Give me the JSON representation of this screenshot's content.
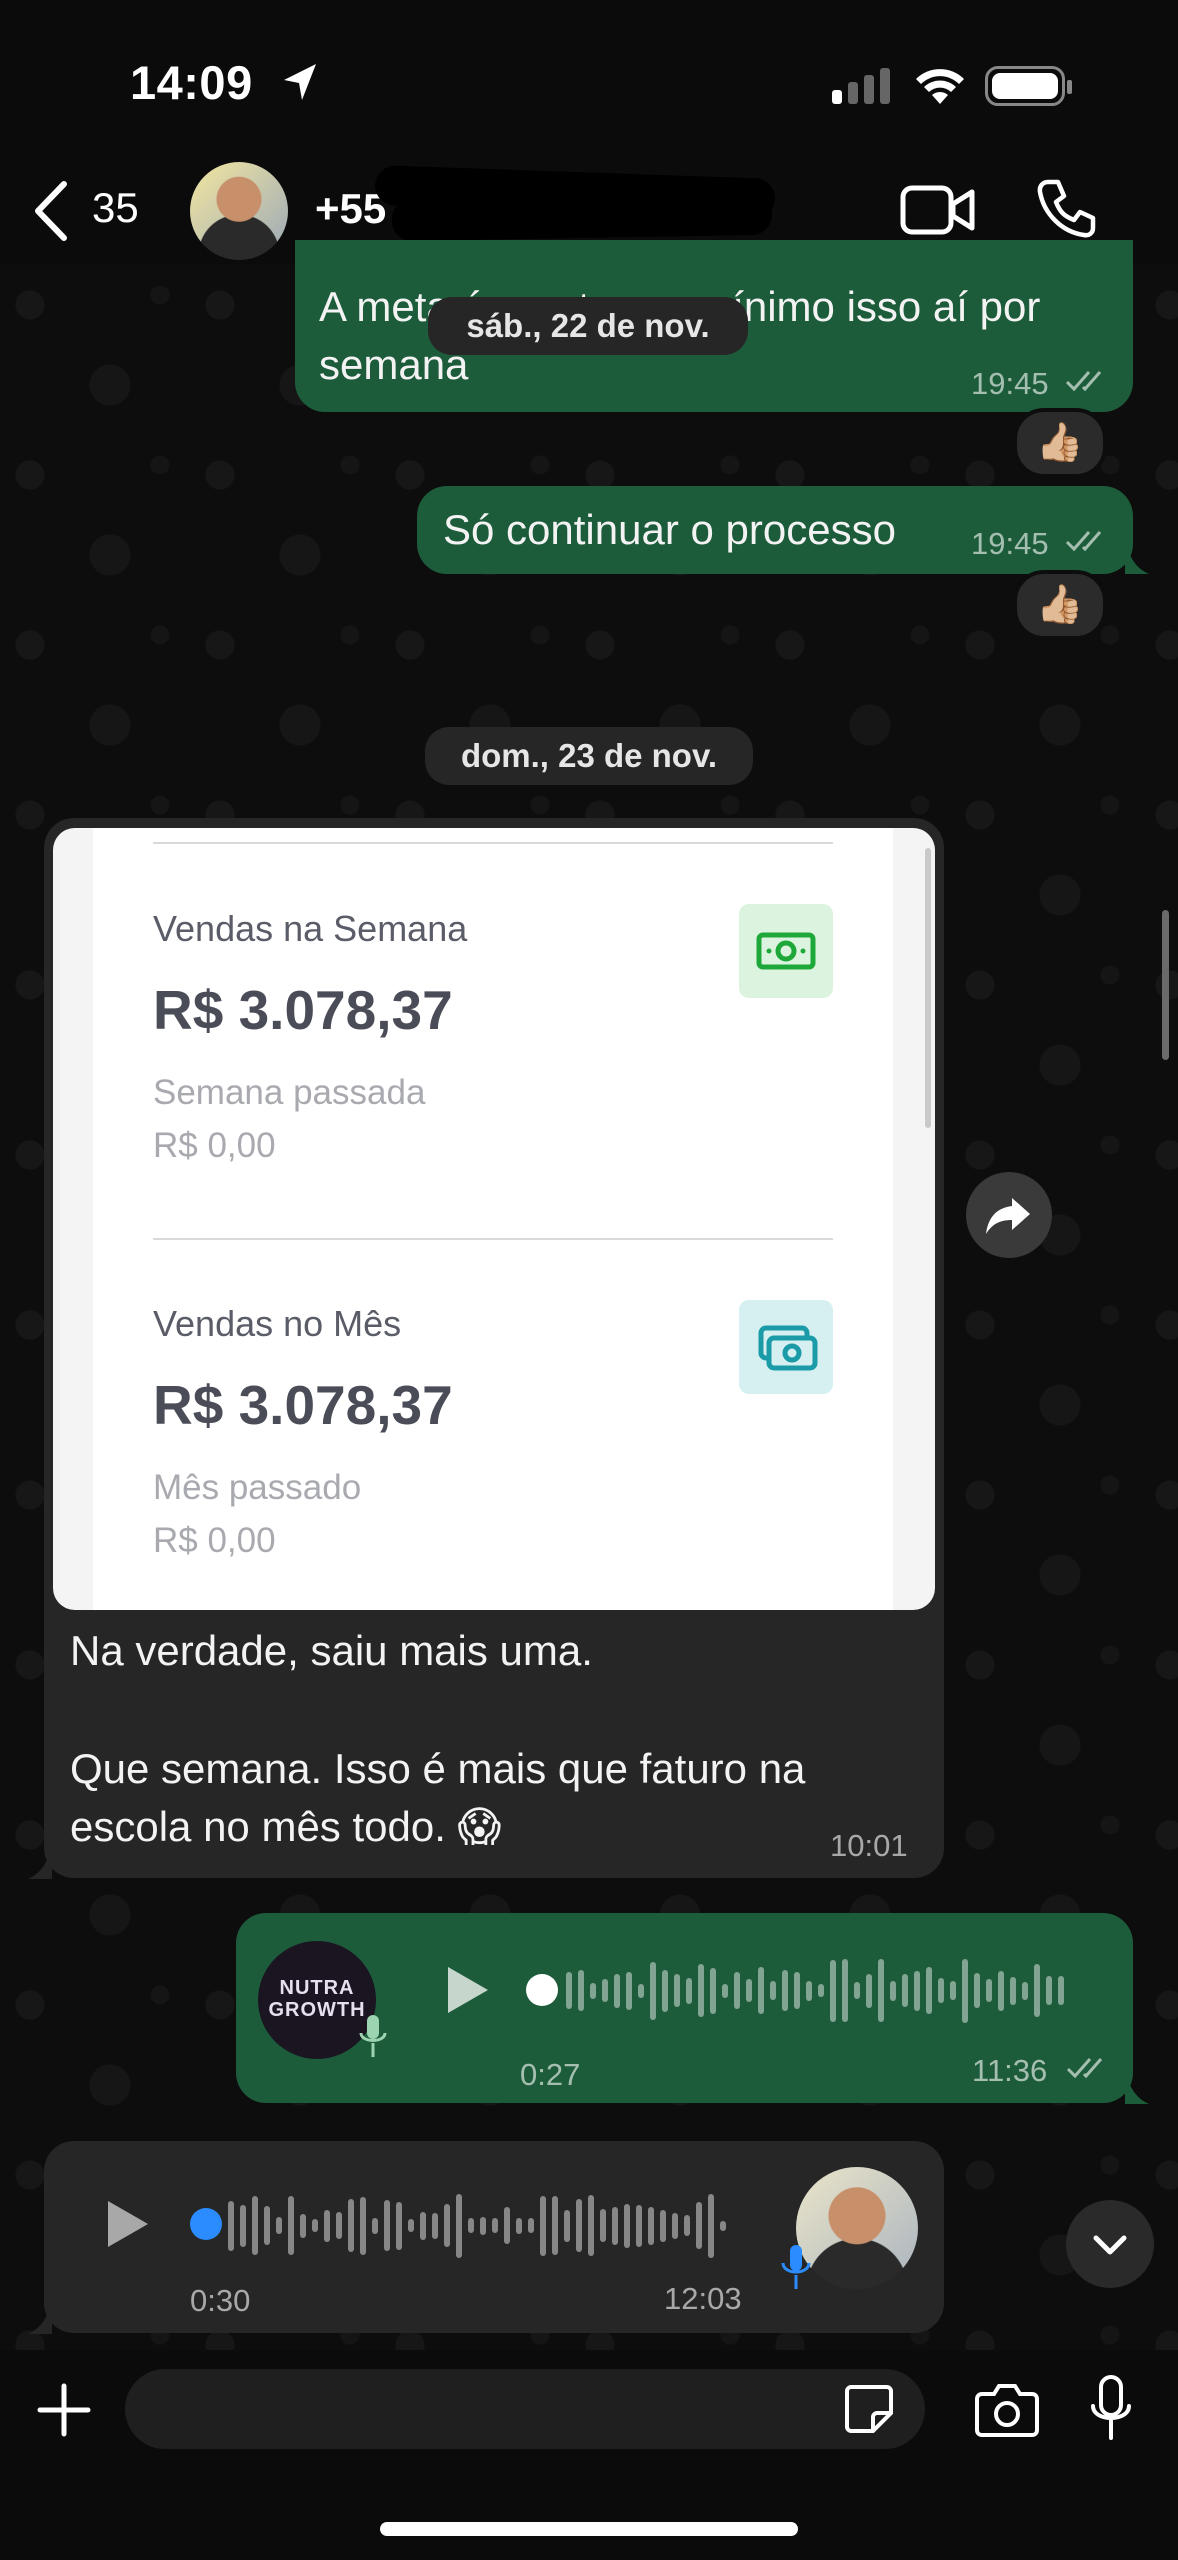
{
  "status_bar": {
    "time": "14:09"
  },
  "header": {
    "back_count": "35",
    "contact": "+55"
  },
  "messages": {
    "m1": {
      "text_line1": "A meta é manter no mínimo isso aí por",
      "text_line2": "semana",
      "time": "19:45",
      "reaction": "👍🏼"
    },
    "m2": {
      "text": "Só continuar o processo",
      "time": "19:45",
      "reaction": "👍🏼"
    }
  },
  "date_pills": {
    "sat": "sáb., 22 de nov.",
    "sun": "dom., 23 de nov."
  },
  "screenshot": {
    "week_label": "Vendas na Semana",
    "week_value": "R$ 3.078,37",
    "last_week_label": "Semana passada",
    "last_week_value": "R$ 0,00",
    "month_label": "Vendas no Mês",
    "month_value": "R$ 3.078,37",
    "last_month_label": "Mês passado",
    "last_month_value": "R$ 0,00"
  },
  "incoming": {
    "line1": "Na verdade, saiu mais uma.",
    "line2": "Que semana. Isso é mais que faturo na",
    "line3": "escola no mês todo. 😱",
    "time": "10:01"
  },
  "audio_out": {
    "duration": "0:27",
    "time": "11:36",
    "avatar_text": "NUTRA GROWTH"
  },
  "audio_in": {
    "duration": "0:30",
    "time": "12:03"
  },
  "colors": {
    "outgoing": "#1d5c3b",
    "incoming": "#262626",
    "accent_green": "#25d366",
    "audio_blue": "#2a8cff"
  }
}
